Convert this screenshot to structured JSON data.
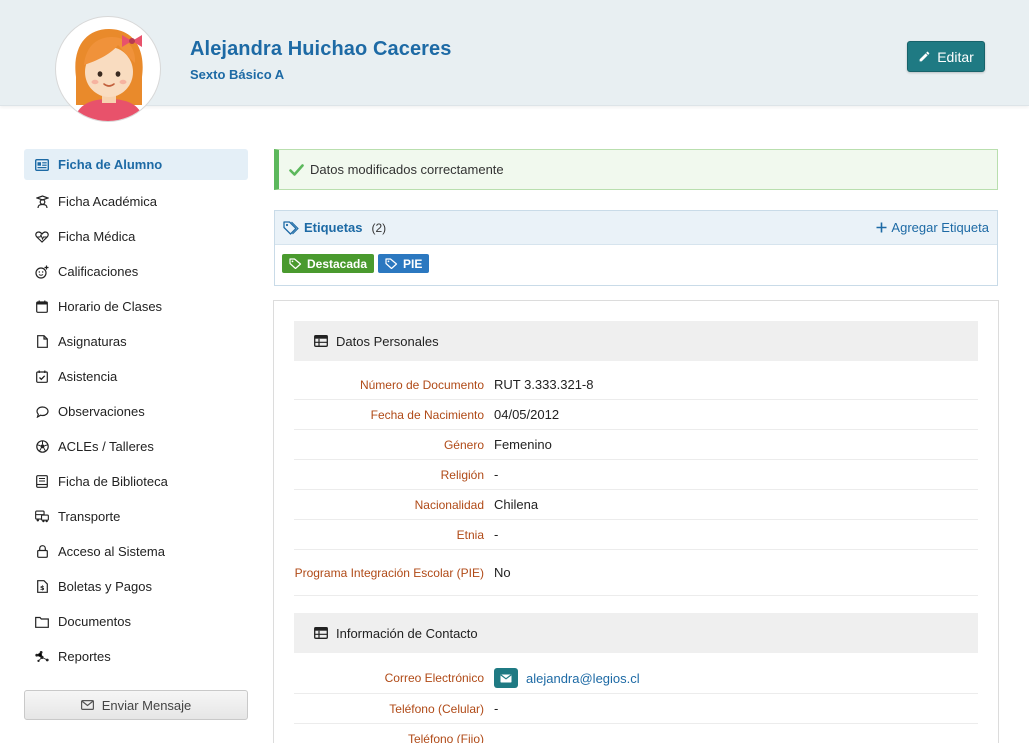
{
  "student": {
    "name": "Alejandra Huichao Caceres",
    "course": "Sexto Básico A"
  },
  "header": {
    "edit_label": "Editar"
  },
  "sidebar": {
    "items": [
      {
        "label": "Ficha de Alumno",
        "icon": "id-card-icon"
      },
      {
        "label": "Ficha Académica",
        "icon": "graduate-icon"
      },
      {
        "label": "Ficha Médica",
        "icon": "heart-pulse-icon"
      },
      {
        "label": "Calificaciones",
        "icon": "smiley-plus-icon"
      },
      {
        "label": "Horario de Clases",
        "icon": "calendar-icon"
      },
      {
        "label": "Asignaturas",
        "icon": "file-icon"
      },
      {
        "label": "Asistencia",
        "icon": "calendar-check-icon"
      },
      {
        "label": "Observaciones",
        "icon": "comment-icon"
      },
      {
        "label": "ACLEs / Talleres",
        "icon": "soccer-ball-icon"
      },
      {
        "label": "Ficha de Biblioteca",
        "icon": "book-icon"
      },
      {
        "label": "Transporte",
        "icon": "bus-icon"
      },
      {
        "label": "Acceso al Sistema",
        "icon": "lock-icon"
      },
      {
        "label": "Boletas y Pagos",
        "icon": "invoice-icon"
      },
      {
        "label": "Documentos",
        "icon": "folder-icon"
      },
      {
        "label": "Reportes",
        "icon": "network-icon"
      }
    ],
    "message_button": "Enviar Mensaje"
  },
  "alert": {
    "text": "Datos modificados correctamente"
  },
  "tags": {
    "title": "Etiquetas",
    "count": "(2)",
    "add_label": "Agregar Etiqueta",
    "items": [
      {
        "label": "Destacada",
        "color": "#4a9a2e"
      },
      {
        "label": "PIE",
        "color": "#2b78c0"
      }
    ]
  },
  "personal": {
    "title": "Datos Personales",
    "rows": [
      {
        "label": "Número de Documento",
        "value": "RUT 3.333.321-8"
      },
      {
        "label": "Fecha de Nacimiento",
        "value": "04/05/2012"
      },
      {
        "label": "Género",
        "value": "Femenino"
      },
      {
        "label": "Religión",
        "value": "-"
      },
      {
        "label": "Nacionalidad",
        "value": "Chilena"
      },
      {
        "label": "Etnia",
        "value": "-"
      },
      {
        "label": "Programa Integración Escolar (PIE)",
        "value": "No"
      }
    ]
  },
  "contact": {
    "title": "Información de Contacto",
    "rows": [
      {
        "label": "Correo Electrónico",
        "value": "alejandra@legios.cl"
      },
      {
        "label": "Teléfono (Celular)",
        "value": "-"
      },
      {
        "label": "Teléfono (Fijo)",
        "value": ""
      }
    ]
  },
  "colors": {
    "brand_blue": "#1d6aa5",
    "teal": "#1f7a83",
    "label_orange": "#b04a17",
    "success_green": "#5cb85c"
  }
}
